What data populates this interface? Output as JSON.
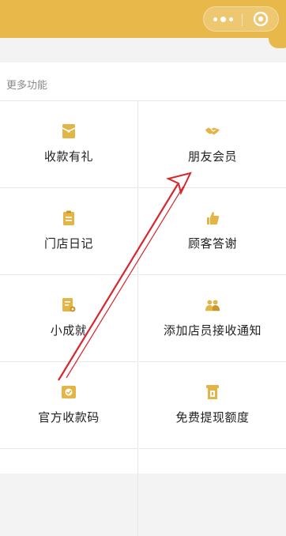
{
  "theme": {
    "accent": "#e8b94a",
    "icon_color": "#e3b446",
    "annotation_color": "#d8252e"
  },
  "header": {
    "capsule": {
      "more_icon": "more-dots-icon",
      "close_icon": "target-circle-icon"
    }
  },
  "section": {
    "title": "更多功能",
    "items": [
      {
        "label": "收款有礼",
        "icon": "red-envelope-icon"
      },
      {
        "label": "朋友会员",
        "icon": "handshake-icon"
      },
      {
        "label": "门店日记",
        "icon": "notepad-icon"
      },
      {
        "label": "顾客答谢",
        "icon": "thumbs-up-icon"
      },
      {
        "label": "小成就",
        "icon": "certificate-icon"
      },
      {
        "label": "添加店员接收通知",
        "icon": "staff-group-icon"
      },
      {
        "label": "官方收款码",
        "icon": "payment-code-icon"
      },
      {
        "label": "免费提现额度",
        "icon": "withdraw-quota-icon"
      }
    ]
  },
  "annotation": {
    "type": "red-arrow",
    "from_item": "官方收款码",
    "to_item": "朋友会员"
  }
}
